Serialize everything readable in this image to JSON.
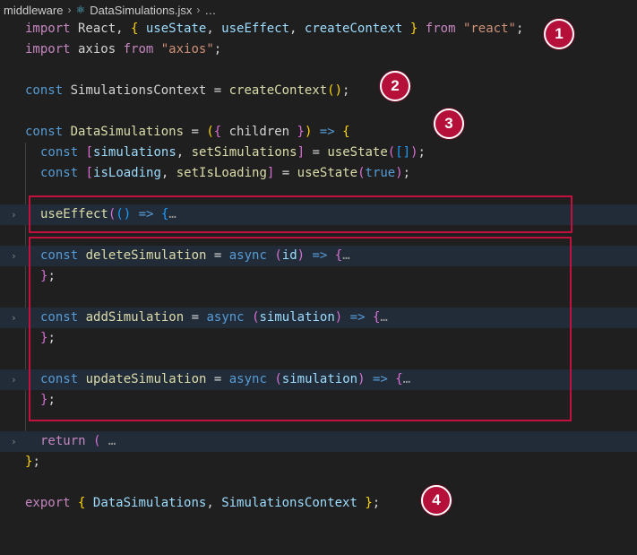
{
  "breadcrumb": {
    "folder": "middleware",
    "file": "DataSimulations.jsx",
    "more": "…",
    "icon": "react-icon"
  },
  "code": {
    "l1": [
      "import",
      " React",
      ", ",
      "{",
      " useState",
      ", ",
      "useEffect",
      ", ",
      "createContext",
      " ",
      "}",
      " ",
      "from",
      " ",
      "\"react\"",
      ";"
    ],
    "l2": [
      "import",
      " axios ",
      "from",
      " ",
      "\"axios\"",
      ";"
    ],
    "l4": [
      "const",
      " SimulationsContext ",
      "= ",
      "createContext",
      "(",
      ")",
      ";"
    ],
    "l6": [
      "const",
      " ",
      "DataSimulations",
      " = ",
      "(",
      "{",
      " children ",
      "}",
      ")",
      " => ",
      "{"
    ],
    "l7": [
      "const",
      " ",
      "[",
      "simulations",
      ", ",
      "setSimulations",
      "]",
      " = ",
      "useState",
      "(",
      "[",
      "]",
      ")",
      ";"
    ],
    "l8": [
      "const",
      " ",
      "[",
      "isLoading",
      ", ",
      "setIsLoading",
      "]",
      " = ",
      "useState",
      "(",
      "true",
      ")",
      ";"
    ],
    "l10": [
      "useEffect",
      "(",
      "(",
      ")",
      " => ",
      "{",
      "…"
    ],
    "l12": [
      "const",
      " ",
      "deleteSimulation",
      " = ",
      "async",
      " ",
      "(",
      "id",
      ")",
      " => ",
      "{",
      "…"
    ],
    "l13": [
      "}",
      ";"
    ],
    "l15": [
      "const",
      " ",
      "addSimulation",
      " = ",
      "async",
      " ",
      "(",
      "simulation",
      ")",
      " => ",
      "{",
      "…"
    ],
    "l16": [
      "}",
      ";"
    ],
    "l18": [
      "const",
      " ",
      "updateSimulation",
      " = ",
      "async",
      " ",
      "(",
      "simulation",
      ")",
      " => ",
      "{",
      "…"
    ],
    "l19": [
      "}",
      ";"
    ],
    "l21": [
      "return",
      " ",
      "(",
      " ",
      "…"
    ],
    "l22": [
      "}",
      ";"
    ],
    "l24": [
      "export",
      " ",
      "{",
      " ",
      "DataSimulations",
      ", ",
      "SimulationsContext",
      " ",
      "}",
      ";"
    ]
  },
  "fold_icon": "chevron-right-icon",
  "badges": [
    "1",
    "2",
    "3",
    "4"
  ],
  "colors": {
    "highlight": "#c4103f",
    "badge": "#b5103a",
    "folded_line": "#222c38"
  }
}
